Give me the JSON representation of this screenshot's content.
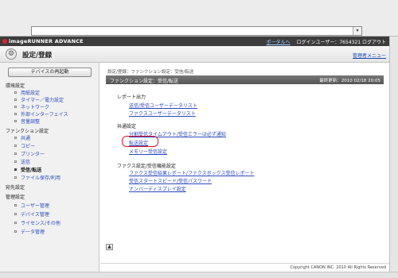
{
  "browser": {
    "url_value": "",
    "dropdown_glyph": "▾"
  },
  "topbar": {
    "logo": "imageRUNNER ADVANCE",
    "portal_link": "ポータルへ",
    "user_info": "ログインユーザー：7654321 ログアウト"
  },
  "titlebar": {
    "title": "設定/登録",
    "admin_link": "管理者メニュー",
    "icon": "gear-icon"
  },
  "sidebar": {
    "restart_button": "デバイスの再起動",
    "group1": "環境設定",
    "group1_items": [
      "用紙設定",
      "タイマー／電力設定",
      "ネットワーク",
      "外部インターフェイス",
      "音量調整"
    ],
    "group2": "ファンクション設定",
    "group2_items": [
      "共通",
      "コピー",
      "プリンター",
      "送信",
      "受信/転送",
      "ファイル保存/利用"
    ],
    "dest": "宛先設定",
    "group3": "管理設定",
    "group3_items": [
      "ユーザー管理",
      "デバイス管理",
      "ライセンス/その他",
      "データ管理"
    ]
  },
  "main": {
    "breadcrumb": "設定/登録：ファンクション設定：受信/転送",
    "section_title": "ファンクション設定：受信/転送",
    "last_updated": "最終更新：2010 02/18 20:05",
    "report_group": "レポート出力",
    "report_links": [
      "送信/受信ユーザーデータリスト",
      "ファクスユーザーデータリスト"
    ],
    "common_group": "共通設定",
    "common_links": [
      "分割受信タイムアウト/受信エラーは必ず通知",
      "転送設定",
      "メモリー受信設定"
    ],
    "fax_group": "ファクス設定/受信機能設定",
    "fax_links": [
      "ファクス受信結果レポート/ファクスボックス受信レポート",
      "受信スタートスピード/受信パスワード",
      "ナンバーディスプレイ設定"
    ],
    "top_button": "▲"
  },
  "footer": {
    "copyright": "Copyright CANON INC. 2010 All Rights Reserved"
  },
  "colors": {
    "link": "#2b49c0",
    "highlight": "#e0142a",
    "header": "#3c3c3c"
  }
}
